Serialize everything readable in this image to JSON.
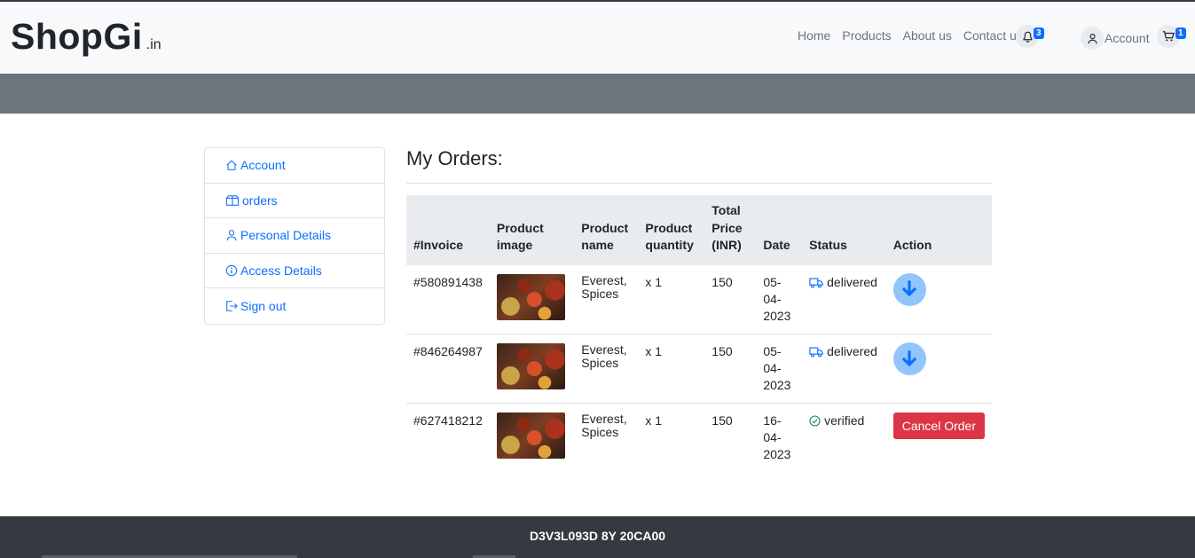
{
  "brand": {
    "name": "ShopGi",
    "tld": ".in"
  },
  "nav": {
    "links": [
      "Home",
      "Products",
      "About us",
      "Contact us"
    ],
    "notifications_count": "3",
    "account_label": "Account",
    "cart_count": "1"
  },
  "sidebar": {
    "items": [
      {
        "label": "Account",
        "icon": "home-icon"
      },
      {
        "label": "orders",
        "icon": "box-icon"
      },
      {
        "label": "Personal Details",
        "icon": "person-icon"
      },
      {
        "label": "Access Details",
        "icon": "info-icon"
      },
      {
        "label": "Sign out",
        "icon": "sign-out-icon"
      }
    ]
  },
  "main": {
    "title": "My Orders:",
    "columns": [
      "#Invoice",
      "Product image",
      "Product name",
      "Product quantity",
      "Total Price (INR)",
      "Date",
      "Status",
      "Action"
    ],
    "orders": [
      {
        "invoice": "#580891438",
        "product_name": "Everest, Spices",
        "quantity": "x 1",
        "total": "150",
        "date": "05-04-2023",
        "status": "delivered",
        "action": "download"
      },
      {
        "invoice": "#846264987",
        "product_name": "Everest, Spices",
        "quantity": "x 1",
        "total": "150",
        "date": "05-04-2023",
        "status": "delivered",
        "action": "download"
      },
      {
        "invoice": "#627418212",
        "product_name": "Everest, Spices",
        "quantity": "x 1",
        "total": "150",
        "date": "16-04-2023",
        "status": "verified",
        "action": "Cancel Order"
      }
    ]
  },
  "footer": {
    "text": "D3V3L093D 8Y 20CA00"
  },
  "colors": {
    "link": "#0d6efd",
    "danger": "#dc3545",
    "dark": "#343a40",
    "banner": "#6c757d",
    "download": "#93c5fd"
  }
}
